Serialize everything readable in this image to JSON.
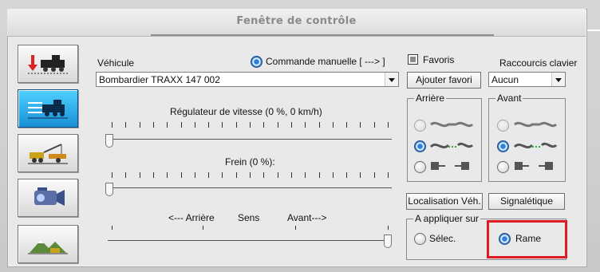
{
  "window": {
    "title": "Fenêtre de contrôle"
  },
  "vehicle": {
    "label": "Véhicule",
    "selected": "Bombardier TRAXX 147 002",
    "manual_command_label": "Commande manuelle [ ---> ]"
  },
  "favorites": {
    "checkbox_label": "Favoris",
    "add_button": "Ajouter favori"
  },
  "shortcuts": {
    "label": "Raccourcis clavier",
    "selected": "Aucun"
  },
  "speed": {
    "label": "Régulateur de vitesse (0 %, 0 km/h)",
    "value_percent": 0
  },
  "brake": {
    "label": "Frein (0 %):",
    "value_percent": 0
  },
  "direction": {
    "left_label": "<--- Arrière",
    "center_label": "Sens",
    "right_label": "Avant--->",
    "position": "avant"
  },
  "rear_group": {
    "label": "Arrière"
  },
  "front_group": {
    "label": "Avant"
  },
  "buttons": {
    "localisation": "Localisation Véh.",
    "signaletique": "Signalétique"
  },
  "apply_on": {
    "label": "A appliquer sur",
    "options": [
      "Sélec.",
      "Rame"
    ],
    "selected": "Rame"
  },
  "toolbar_icons": [
    "train-red-arrow-icon",
    "train-active-icon",
    "crane-icon",
    "camera-icon",
    "landscape-icon"
  ],
  "colors": {
    "accent_blue": "#1a8fd6",
    "highlight_red": "#e01b24"
  }
}
